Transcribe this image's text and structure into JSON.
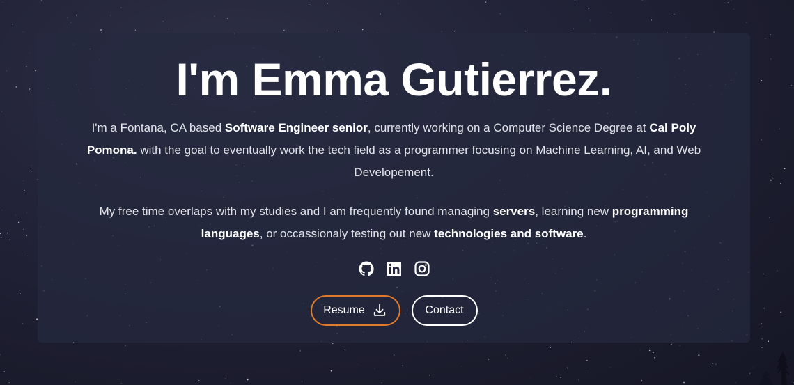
{
  "hero": {
    "title": "I'm Emma Gutierrez.",
    "intro": {
      "t1": "I'm a Fontana, CA based ",
      "b1": "Software Engineer senior",
      "t2": ", currently working on a Computer Science Degree at ",
      "b2": "Cal Poly Pomona.",
      "t3": " with the goal to eventually work the tech field as a programmer focusing on Machine Learning, AI, and Web Developement."
    },
    "hobbies": {
      "t1": "My free time overlaps with my studies and I am frequently found managing ",
      "b1": "servers",
      "t2": ", learning new ",
      "b2": "programming languages",
      "t3": ", or occassionaly testing out new ",
      "b3": "technologies and software",
      "t4": "."
    }
  },
  "socials": [
    {
      "icon": "github-icon"
    },
    {
      "icon": "linkedin-icon"
    },
    {
      "icon": "instagram-icon"
    }
  ],
  "buttons": {
    "resume_label": "Resume",
    "contact_label": "Contact"
  },
  "colors": {
    "accent": "#e07b2c",
    "card_bg": "rgba(38,41,62,0.72)",
    "background": "#1f2033"
  }
}
